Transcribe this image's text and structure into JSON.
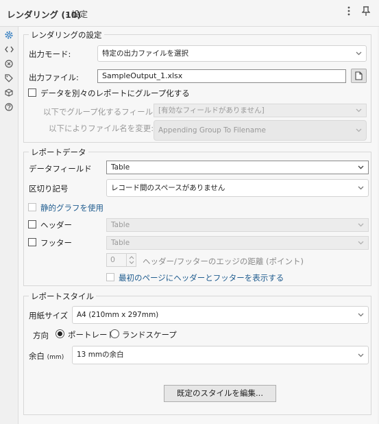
{
  "header": {
    "title": "レンダリング (10)",
    "subtitle": "- 設定",
    "menu_icon": "more-vertical-icon",
    "pin_icon": "pin-icon"
  },
  "sidebar": {
    "icons": [
      "gear-icon",
      "code-icon",
      "close-circle-icon",
      "tag-icon",
      "cube-icon",
      "help-icon"
    ]
  },
  "render_settings": {
    "legend": "レンダリングの設定",
    "output_mode_label": "出力モード:",
    "output_mode_value": "特定の出力ファイルを選択",
    "output_file_label": "出力ファイル:",
    "output_file_value": "SampleOutput_1.xlsx",
    "group_checkbox_label": "データを別々のレポートにグループ化する",
    "group_field_label": "以下でグループ化するフィールド:",
    "group_field_value": "[有効なフィールドがありません]",
    "rename_label": "以下によりファイル名を変更:",
    "rename_value": "Appending Group To Filename"
  },
  "report_data": {
    "legend": "レポートデータ",
    "data_field_label": "データフィールド",
    "data_field_value": "Table",
    "separator_label": "区切り記号",
    "separator_value": "レコード間のスペースがありません",
    "static_graph_label": "静的グラフを使用",
    "header_label": "ヘッダー",
    "header_value": "Table",
    "footer_label": "フッター",
    "footer_value": "Table",
    "edge_distance_value": "0",
    "edge_distance_label": "ヘッダー/フッターのエッジの距離 (ポイント)",
    "first_page_label": "最初のページにヘッダーとフッターを表示する"
  },
  "report_style": {
    "legend": "レポートスタイル",
    "paper_size_label": "用紙サイズ",
    "paper_size_value": "A4 (210mm x 297mm)",
    "orientation_label": "方向",
    "portrait_label": "ポートレート",
    "landscape_label": "ランドスケープ",
    "margin_label": "余白",
    "margin_unit": "(mm)",
    "margin_value": "13 mmの余白",
    "edit_button_label": "既定のスタイルを編集..."
  },
  "colors": {
    "accent": "#2f7bbf",
    "static_graph_text": "#1f5c8f"
  }
}
